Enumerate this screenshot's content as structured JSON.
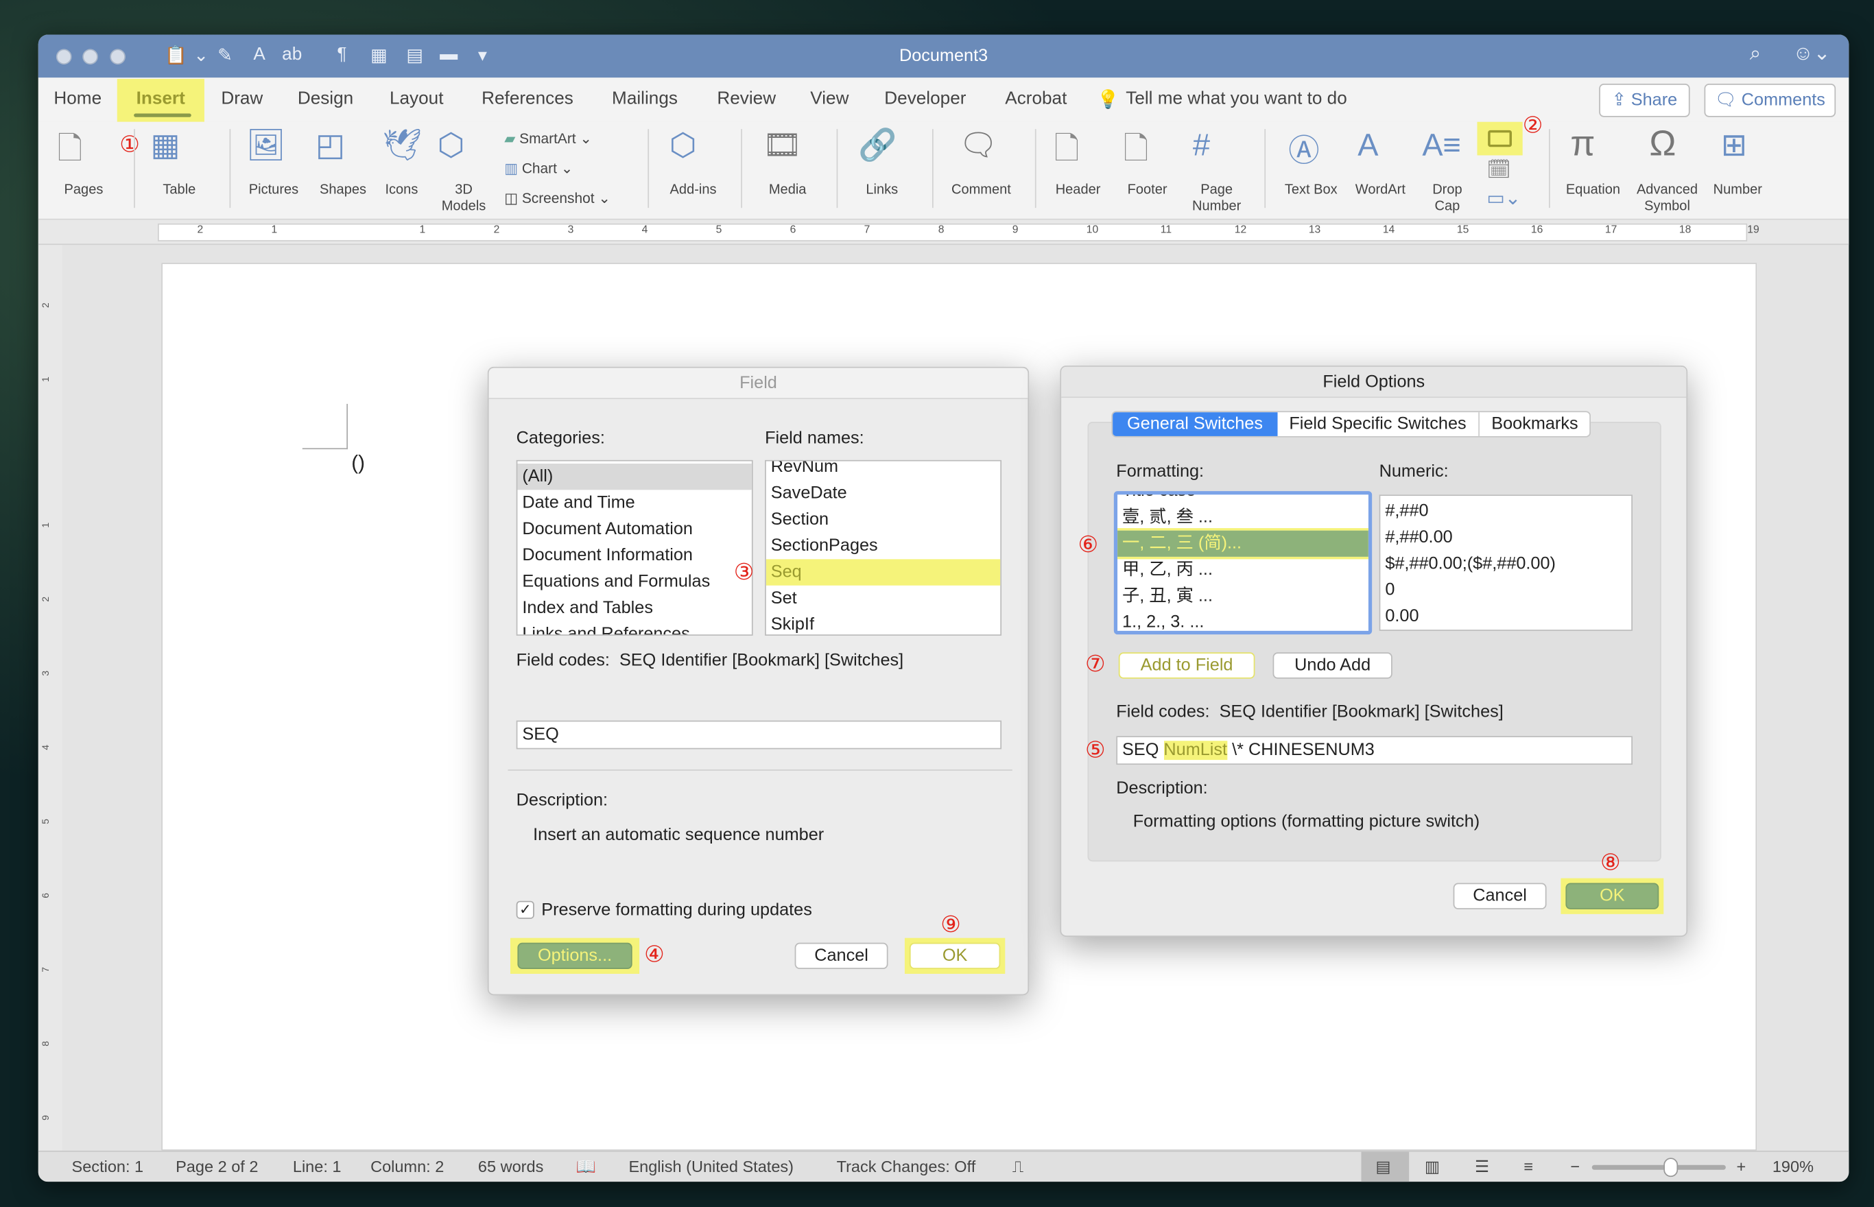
{
  "window": {
    "title": "Document3",
    "accent": "#6b8bb9",
    "highlight": "#f5f37a"
  },
  "menu_tabs": [
    "Home",
    "Insert",
    "Draw",
    "Design",
    "Layout",
    "References",
    "Mailings",
    "Review",
    "View",
    "Developer",
    "Acrobat"
  ],
  "active_tab": "Insert",
  "tell_me": "Tell me what you want to do",
  "share": "Share",
  "comments": "Comments",
  "ribbon": {
    "pages": "Pages",
    "table": "Table",
    "pictures": "Pictures",
    "shapes": "Shapes",
    "icons": "Icons",
    "models_1": "3D",
    "models_2": "Models",
    "smartart": "SmartArt",
    "chart": "Chart",
    "screenshot": "Screenshot",
    "addins": "Add-ins",
    "media": "Media",
    "links": "Links",
    "comment": "Comment",
    "header": "Header",
    "footer": "Footer",
    "page_number_1": "Page",
    "page_number_2": "Number",
    "text_box": "Text Box",
    "wordart": "WordArt",
    "drop_cap_1": "Drop",
    "drop_cap_2": "Cap",
    "equation": "Equation",
    "adv_symbol_1": "Advanced",
    "adv_symbol_2": "Symbol",
    "number": "Number"
  },
  "ruler_labels": [
    "2",
    "1",
    "1",
    "2",
    "3",
    "4",
    "5",
    "6",
    "7",
    "8",
    "9",
    "10",
    "11",
    "12",
    "13",
    "14",
    "15",
    "16",
    "17",
    "18",
    "19"
  ],
  "vruler_labels": [
    "2",
    "1",
    "1",
    "2",
    "3",
    "4",
    "5",
    "6",
    "7",
    "8",
    "9"
  ],
  "document": {
    "field_placeholder": "()"
  },
  "annotations": {
    "n1": "①",
    "n2": "②",
    "n3": "③",
    "n4": "④",
    "n5": "⑤",
    "n6": "⑥",
    "n7": "⑦",
    "n8": "⑧",
    "n9": "⑨"
  },
  "field_dialog": {
    "title": "Field",
    "categories_label": "Categories:",
    "field_names_label": "Field names:",
    "categories": [
      "(All)",
      "Date and Time",
      "Document Automation",
      "Document Information",
      "Equations and Formulas",
      "Index and Tables",
      "Links and References"
    ],
    "selected_category": "(All)",
    "field_names": [
      "RevNum",
      "SaveDate",
      "Section",
      "SectionPages",
      "Seq",
      "Set",
      "SkipIf"
    ],
    "selected_field": "Seq",
    "field_codes_label": "Field codes:",
    "field_codes_syntax": "SEQ Identifier [Bookmark] [Switches]",
    "field_code_value": "SEQ",
    "description_label": "Description:",
    "description": "Insert an automatic sequence number",
    "preserve_label": "Preserve formatting during updates",
    "preserve_checked": true,
    "options": "Options...",
    "cancel": "Cancel",
    "ok": "OK"
  },
  "options_dialog": {
    "title": "Field Options",
    "tabs": [
      "General Switches",
      "Field Specific Switches",
      "Bookmarks"
    ],
    "active_tab": "General Switches",
    "formatting_label": "Formatting:",
    "numeric_label": "Numeric:",
    "formatting": [
      "Title case",
      "壹, 贰, 叁 ...",
      "一, 二, 三 (简)...",
      "甲, 乙, 丙 ...",
      "子, 丑, 寅 ...",
      "1., 2., 3. ..."
    ],
    "selected_formatting": "一, 二, 三 (简)...",
    "numeric": [
      "#,##0",
      "#,##0.00",
      "$#,##0.00;($#,##0.00)",
      "0",
      "0.00"
    ],
    "add_to_field": "Add to Field",
    "undo_add": "Undo Add",
    "field_codes_label": "Field codes:",
    "field_codes_syntax": "SEQ Identifier [Bookmark] [Switches]",
    "code_seq": "SEQ",
    "code_identifier": "NumList",
    "code_switch": "\\* CHINESENUM3",
    "description_label": "Description:",
    "description": "Formatting options (formatting picture switch)",
    "cancel": "Cancel",
    "ok": "OK"
  },
  "status": {
    "section": "Section: 1",
    "page": "Page 2 of 2",
    "line": "Line: 1",
    "column": "Column: 2",
    "words": "65 words",
    "language": "English (United States)",
    "track": "Track Changes: Off",
    "zoom": "190%",
    "zoom_level_percent": 190
  }
}
